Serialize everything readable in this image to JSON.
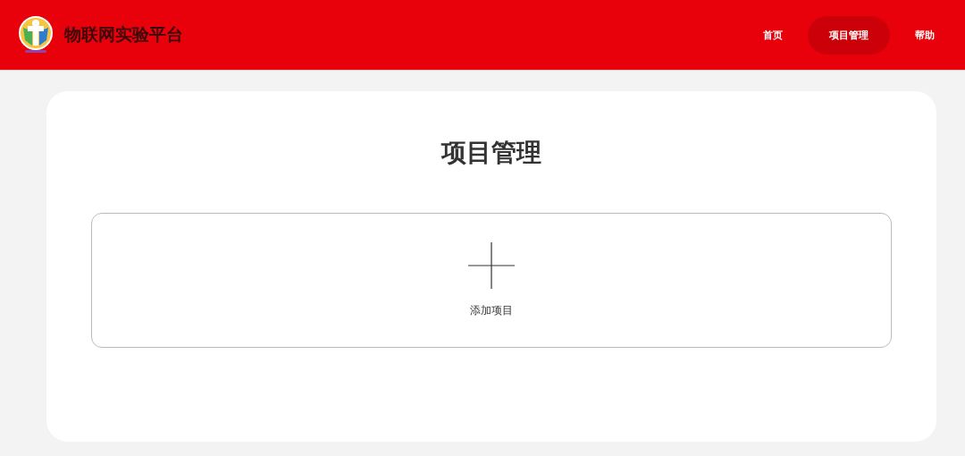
{
  "header": {
    "title": "物联网实验平台"
  },
  "nav": [
    {
      "label": "首页",
      "selected": false
    },
    {
      "label": "项目管理",
      "selected": true
    },
    {
      "label": "帮助",
      "selected": false
    }
  ],
  "page": {
    "heading": "项目管理",
    "add_card": {
      "label": "添加项目"
    }
  }
}
